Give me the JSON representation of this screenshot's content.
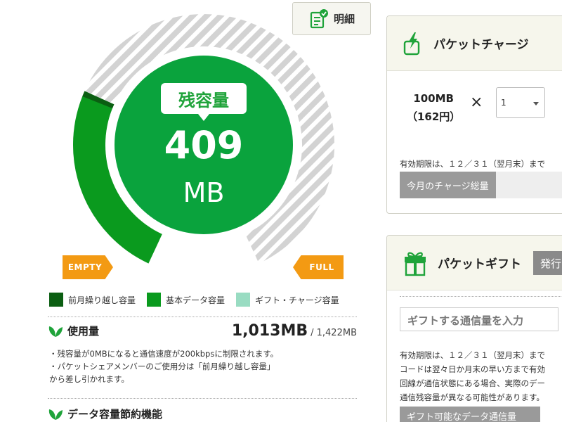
{
  "detail": {
    "label": "明細"
  },
  "gauge": {
    "label": "残容量",
    "value": "409",
    "unit": "MB",
    "remaining_fraction": 0.288,
    "colors": {
      "basic": "#0a9a1e",
      "carryover": "#0b5e12",
      "gift": "#99dcc2",
      "track": "#d9d9d9",
      "center": "#0aa33d"
    },
    "empty_label": "EMPTY",
    "full_label": "FULL"
  },
  "legend": [
    {
      "label": "前月繰り越し容量",
      "color": "#0b5e12"
    },
    {
      "label": "基本データ容量",
      "color": "#0a9a1e"
    },
    {
      "label": "ギフト・チャージ容量",
      "color": "#99dcc2"
    }
  ],
  "usage": {
    "title": "使用量",
    "used": "1,013MB",
    "total": "/ 1,422MB",
    "notes": [
      "・残容量が0MBになると通信速度が200kbpsに制限されます。",
      "・パケットシェアメンバーのご使用分は「前月繰り越し容量」",
      "から差し引かれます。"
    ]
  },
  "savings": {
    "title": "データ容量節約機能"
  },
  "charge": {
    "title": "パケットチャージ",
    "amount": "100MB",
    "price": "（162円）",
    "times": "×",
    "quantity": "1",
    "expire": "有効期限は、１２／３１（翌月末）まで",
    "total_label": "今月のチャージ総量"
  },
  "gift": {
    "title": "パケットギフト",
    "issue_label": "発行",
    "input_placeholder": "ギフトする通信量を入力",
    "notes": [
      "有効期限は、１２／３１（翌月末）まで",
      "コードは翌々日か月末の早い方まで有効",
      "回線が通信状態にある場合、実際のデー",
      "通信残容量が異なる可能性があります。"
    ],
    "available_label": "ギフト可能なデータ通信量"
  }
}
